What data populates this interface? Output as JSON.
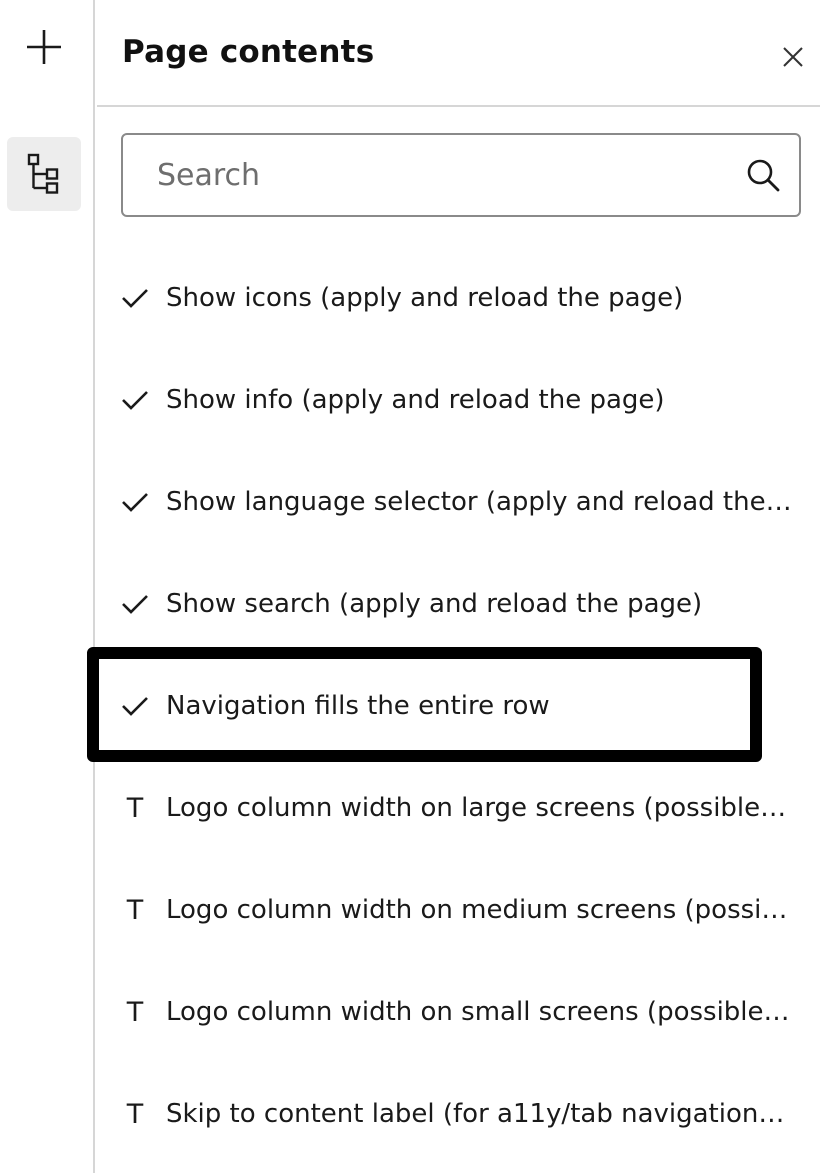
{
  "rail": {
    "add_icon": "plus-icon",
    "tree_icon": "tree-structure-icon"
  },
  "panel": {
    "title": "Page contents",
    "close_icon": "close-icon"
  },
  "search": {
    "placeholder": "Search",
    "value": "",
    "icon": "search-icon"
  },
  "items": [
    {
      "type": "checkbox",
      "icon": "check-icon",
      "label": "Show icons (apply and reload the page)"
    },
    {
      "type": "checkbox",
      "icon": "check-icon",
      "label": "Show info (apply and reload the page)"
    },
    {
      "type": "checkbox",
      "icon": "check-icon",
      "label": "Show language selector (apply and reload the…"
    },
    {
      "type": "checkbox",
      "icon": "check-icon",
      "label": "Show search (apply and reload the page)"
    },
    {
      "type": "checkbox",
      "icon": "check-icon",
      "label": "Navigation fills the entire row",
      "highlighted": true
    },
    {
      "type": "text",
      "icon": "T",
      "label": "Logo column width on large screens (possible …"
    },
    {
      "type": "text",
      "icon": "T",
      "label": "Logo column width on medium screens (possi…"
    },
    {
      "type": "text",
      "icon": "T",
      "label": "Logo column width on small screens (possible …"
    },
    {
      "type": "text",
      "icon": "T",
      "label": "Skip to content label (for a11y/tab navigation …"
    }
  ],
  "highlight_color": "#000000"
}
